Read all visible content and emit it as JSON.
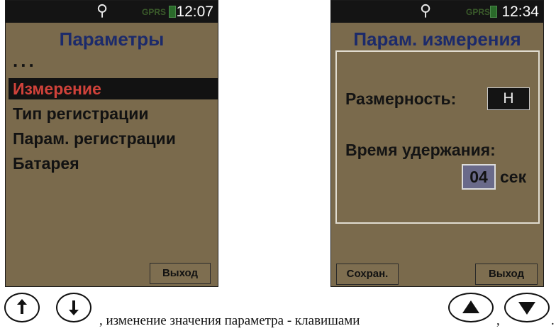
{
  "left_screen": {
    "status": {
      "usb_icon": "usb-icon",
      "network": "GPRS",
      "time": "12:07"
    },
    "title": "Параметры",
    "ellipsis": "...",
    "menu": [
      {
        "label": "Измерение",
        "selected": true
      },
      {
        "label": "Тип регистрации",
        "selected": false
      },
      {
        "label": "Парам. регистрации",
        "selected": false
      },
      {
        "label": "Батарея",
        "selected": false
      }
    ],
    "softkey_right": "Выход"
  },
  "right_screen": {
    "status": {
      "usb_icon": "usb-icon",
      "network": "GPRS",
      "time": "12:34"
    },
    "title": "Парам. измерения",
    "dimension_label": "Размерность:",
    "dimension_value": "Н",
    "hold_time_label": "Время удержания:",
    "hold_time_value": "04",
    "hold_time_unit": "сек",
    "softkey_left": "Сохран.",
    "softkey_right": "Выход"
  },
  "caption": {
    "text": ", изменение значения параметра - клавишами",
    "separator": ",",
    "end": ".",
    "keys": [
      "arrow-up-key",
      "arrow-down-key",
      "triangle-up-key",
      "triangle-down-key"
    ]
  },
  "colors": {
    "screen_bg": "#7a6a4c",
    "title": "#1c2a6a",
    "selected_text": "#d0423a",
    "status_bar": "#141414"
  }
}
